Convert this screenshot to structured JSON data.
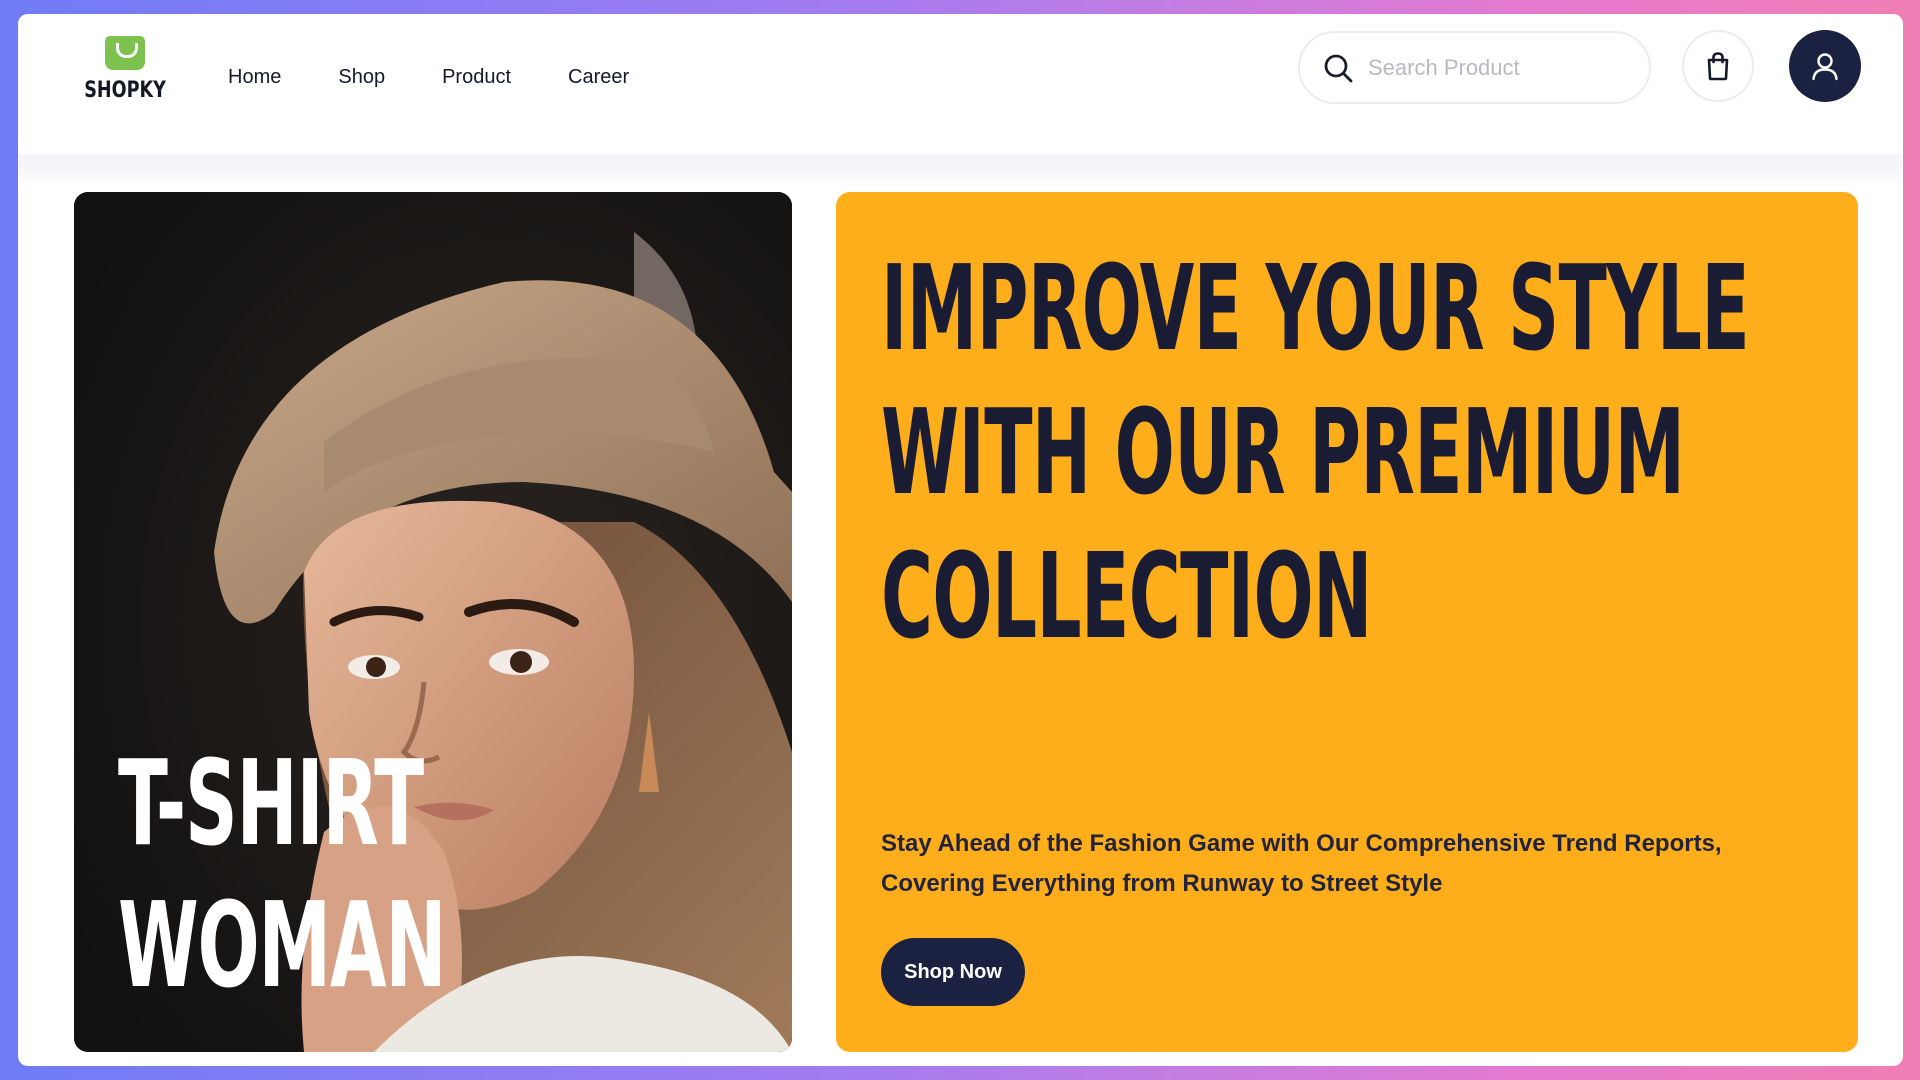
{
  "brand": {
    "name": "SHOPKY",
    "logo_color": "#7dc24f"
  },
  "nav": {
    "items": [
      {
        "label": "Home"
      },
      {
        "label": "Shop"
      },
      {
        "label": "Product"
      },
      {
        "label": "Career"
      }
    ]
  },
  "search": {
    "placeholder": "Search Product",
    "value": "",
    "icon": "search-icon"
  },
  "header_actions": {
    "cart_icon": "shopping-bag-icon",
    "profile_icon": "user-icon"
  },
  "hero_image_card": {
    "title_line1": "T-SHIRT",
    "title_line2": "WOMAN"
  },
  "promo": {
    "headline_line1": "IMPROVE YOUR STYLE",
    "headline_line2": "WITH OUR PREMIUM",
    "headline_line3": "COLLECTION",
    "subtext": "Stay Ahead of the Fashion Game with Our Comprehensive Trend Reports, Covering Everything from Runway to Street Style",
    "cta_label": "Shop Now"
  },
  "colors": {
    "accent": "#fdae1a",
    "dark": "#1b2140",
    "brand_green": "#7dc24f"
  }
}
